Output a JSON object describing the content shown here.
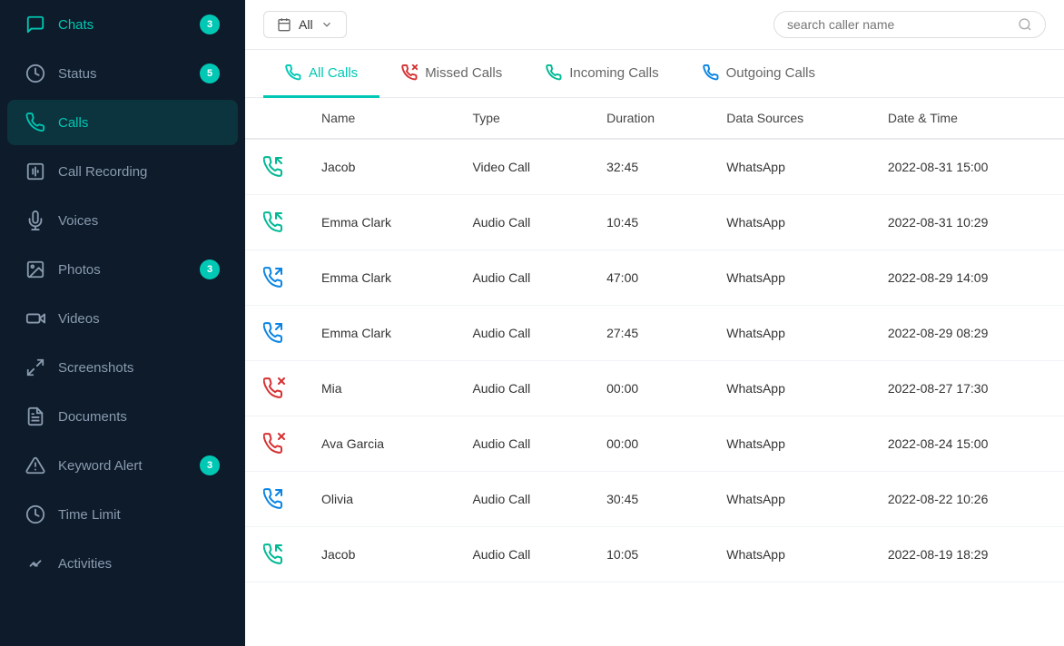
{
  "sidebar": {
    "items": [
      {
        "id": "chats",
        "label": "Chats",
        "badge": 3,
        "active": false,
        "icon": "chat"
      },
      {
        "id": "status",
        "label": "Status",
        "badge": 5,
        "active": false,
        "icon": "status"
      },
      {
        "id": "calls",
        "label": "Calls",
        "badge": null,
        "active": true,
        "icon": "phone"
      },
      {
        "id": "call-recording",
        "label": "Call Recording",
        "badge": null,
        "active": false,
        "icon": "record"
      },
      {
        "id": "voices",
        "label": "Voices",
        "badge": null,
        "active": false,
        "icon": "voice"
      },
      {
        "id": "photos",
        "label": "Photos",
        "badge": 3,
        "active": false,
        "icon": "photo"
      },
      {
        "id": "videos",
        "label": "Videos",
        "badge": null,
        "active": false,
        "icon": "video"
      },
      {
        "id": "screenshots",
        "label": "Screenshots",
        "badge": null,
        "active": false,
        "icon": "screenshot"
      },
      {
        "id": "documents",
        "label": "Documents",
        "badge": null,
        "active": false,
        "icon": "document"
      },
      {
        "id": "keyword-alert",
        "label": "Keyword Alert",
        "badge": 3,
        "active": false,
        "icon": "alert"
      },
      {
        "id": "time-limit",
        "label": "Time Limit",
        "badge": null,
        "active": false,
        "icon": "clock"
      },
      {
        "id": "activities",
        "label": "Activities",
        "badge": null,
        "active": false,
        "icon": "activity"
      }
    ]
  },
  "toolbar": {
    "filter_label": "All",
    "search_placeholder": "search caller name"
  },
  "tabs": [
    {
      "id": "all",
      "label": "All Calls",
      "active": true,
      "icon_type": "incoming_green"
    },
    {
      "id": "missed",
      "label": "Missed Calls",
      "active": false,
      "icon_type": "missed"
    },
    {
      "id": "incoming",
      "label": "Incoming Calls",
      "active": false,
      "icon_type": "incoming_green"
    },
    {
      "id": "outgoing",
      "label": "Outgoing Calls",
      "active": false,
      "icon_type": "outgoing"
    }
  ],
  "table": {
    "columns": [
      "",
      "Name",
      "Type",
      "Duration",
      "Data Sources",
      "Date & Time"
    ],
    "rows": [
      {
        "icon": "incoming",
        "name": "Jacob",
        "type": "Video Call",
        "duration": "32:45",
        "source": "WhatsApp",
        "datetime": "2022-08-31 15:00"
      },
      {
        "icon": "incoming",
        "name": "Emma Clark",
        "type": "Audio Call",
        "duration": "10:45",
        "source": "WhatsApp",
        "datetime": "2022-08-31 10:29"
      },
      {
        "icon": "outgoing",
        "name": "Emma Clark",
        "type": "Audio Call",
        "duration": "47:00",
        "source": "WhatsApp",
        "datetime": "2022-08-29 14:09"
      },
      {
        "icon": "outgoing",
        "name": "Emma Clark",
        "type": "Audio Call",
        "duration": "27:45",
        "source": "WhatsApp",
        "datetime": "2022-08-29 08:29"
      },
      {
        "icon": "missed",
        "name": "Mia",
        "type": "Audio Call",
        "duration": "00:00",
        "source": "WhatsApp",
        "datetime": "2022-08-27 17:30"
      },
      {
        "icon": "missed",
        "name": "Ava Garcia",
        "type": "Audio Call",
        "duration": "00:00",
        "source": "WhatsApp",
        "datetime": "2022-08-24 15:00"
      },
      {
        "icon": "outgoing",
        "name": "Olivia",
        "type": "Audio Call",
        "duration": "30:45",
        "source": "WhatsApp",
        "datetime": "2022-08-22 10:26"
      },
      {
        "icon": "incoming",
        "name": "Jacob",
        "type": "Audio Call",
        "duration": "10:05",
        "source": "WhatsApp",
        "datetime": "2022-08-19 18:29"
      }
    ]
  },
  "colors": {
    "teal": "#00c8b4",
    "sidebar_bg": "#0d1b2a",
    "incoming_green": "#00b894",
    "outgoing_blue": "#0984e3",
    "missed_red": "#d63031"
  }
}
